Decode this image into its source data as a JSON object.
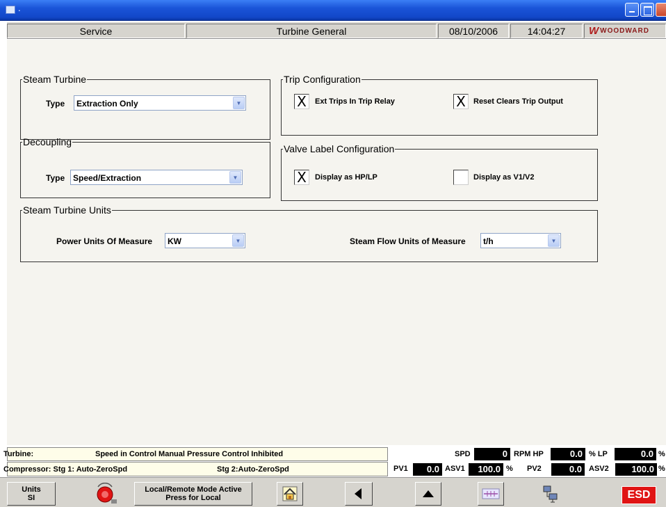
{
  "window": {
    "title": "."
  },
  "header": {
    "mode": "Service",
    "screen": "Turbine General",
    "date": "08/10/2006",
    "time": "14:04:27",
    "logo": "WOODWARD"
  },
  "steam_turbine": {
    "legend": "Steam Turbine",
    "type_label": "Type",
    "type_value": "Extraction Only"
  },
  "trip_config": {
    "legend": "Trip Configuration",
    "ext_trips": {
      "label": "Ext Trips In Trip Relay",
      "checked": true
    },
    "reset_clears": {
      "label": "Reset Clears Trip Output",
      "checked": true
    }
  },
  "decoupling": {
    "legend": "Decoupling",
    "type_label": "Type",
    "type_value": "Speed/Extraction"
  },
  "valve_label": {
    "legend": "Valve Label Configuration",
    "hp_lp": {
      "label": "Display as HP/LP",
      "checked": true
    },
    "v1_v2": {
      "label": "Display as V1/V2",
      "checked": false
    }
  },
  "units": {
    "legend": "Steam Turbine Units",
    "power_label": "Power Units Of Measure",
    "power_value": "KW",
    "flow_label": "Steam Flow Units of Measure",
    "flow_value": "t/h"
  },
  "status": {
    "turbine_label": "Turbine:",
    "turbine_text": "Speed in Control Manual Pressure Control Inhibited",
    "compressor_stg1": "Compressor: Stg 1: Auto-ZeroSpd",
    "compressor_stg2": "Stg 2:Auto-ZeroSpd",
    "spd_label": "SPD",
    "spd_value": "0",
    "rpm_hp_label": "RPM HP",
    "hp_value": "0.0",
    "pct_lp_label": "% LP",
    "lp_value": "0.0",
    "pct1": "%",
    "pv1_label": "PV1",
    "pv1_value": "0.0",
    "asv1_label": "ASV1",
    "asv1_value": "100.0",
    "pct2": "%",
    "pv2_label": "PV2",
    "pv2_value": "0.0",
    "asv2_label": "ASV2",
    "asv2_value": "100.0",
    "pct3": "%"
  },
  "toolbar": {
    "units_line1": "Units",
    "units_line2": "SI",
    "mode_line1": "Local/Remote Mode Active",
    "mode_line2": "Press for Local",
    "esd": "ESD",
    "icons": [
      "alarm-horn-icon",
      "home-icon",
      "back-arrow-icon",
      "up-arrow-icon",
      "trend-icon",
      "network-icon"
    ]
  },
  "check_glyph": "X",
  "dropdown_glyph": "▼"
}
